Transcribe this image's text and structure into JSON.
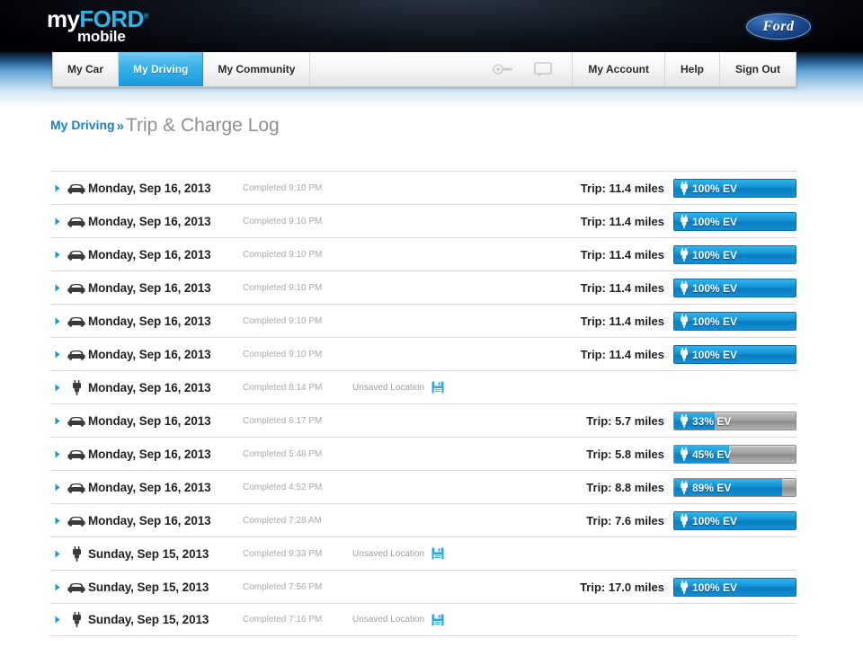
{
  "brand": {
    "logo_my": "my",
    "logo_ford": "FORD",
    "logo_tm": "®",
    "logo_mobile": "mobile",
    "oval_text": "Ford",
    "accent_blue": "#29b6ea",
    "active_tab_blue": "#1a9ade",
    "link_blue": "#1b7fc4"
  },
  "nav": {
    "tabs": [
      {
        "label": "My Car",
        "active": false
      },
      {
        "label": "My Driving",
        "active": true
      },
      {
        "label": "My Community",
        "active": false
      }
    ],
    "icons": [
      {
        "name": "key-icon"
      },
      {
        "name": "message-icon"
      }
    ],
    "links": [
      {
        "label": "My Account"
      },
      {
        "label": "Help"
      },
      {
        "label": "Sign Out"
      }
    ]
  },
  "breadcrumb": {
    "link": "My Driving",
    "separator": "»",
    "current": "Trip & Charge Log"
  },
  "log": {
    "rows": [
      {
        "type": "trip",
        "icon": "car-icon",
        "date": "Monday, Sep 16, 2013",
        "completed": "Completed 9:10 PM",
        "location": null,
        "trip": "Trip: 11.4 miles",
        "ev_label": "100% EV",
        "ev_percent": 100
      },
      {
        "type": "trip",
        "icon": "car-icon",
        "date": "Monday, Sep 16, 2013",
        "completed": "Completed 9:10 PM",
        "location": null,
        "trip": "Trip: 11.4 miles",
        "ev_label": "100% EV",
        "ev_percent": 100
      },
      {
        "type": "trip",
        "icon": "car-icon",
        "date": "Monday, Sep 16, 2013",
        "completed": "Completed 9:10 PM",
        "location": null,
        "trip": "Trip: 11.4 miles",
        "ev_label": "100% EV",
        "ev_percent": 100
      },
      {
        "type": "trip",
        "icon": "car-icon",
        "date": "Monday, Sep 16, 2013",
        "completed": "Completed 9:10 PM",
        "location": null,
        "trip": "Trip: 11.4 miles",
        "ev_label": "100% EV",
        "ev_percent": 100
      },
      {
        "type": "trip",
        "icon": "car-icon",
        "date": "Monday, Sep 16, 2013",
        "completed": "Completed 9:10 PM",
        "location": null,
        "trip": "Trip: 11.4 miles",
        "ev_label": "100% EV",
        "ev_percent": 100
      },
      {
        "type": "trip",
        "icon": "car-icon",
        "date": "Monday, Sep 16, 2013",
        "completed": "Completed 9:10 PM",
        "location": null,
        "trip": "Trip: 11.4 miles",
        "ev_label": "100% EV",
        "ev_percent": 100
      },
      {
        "type": "charge",
        "icon": "plug-icon",
        "date": "Monday, Sep 16, 2013",
        "completed": "Completed 8:14 PM",
        "location": "Unsaved Location",
        "trip": null,
        "ev_label": null,
        "ev_percent": null
      },
      {
        "type": "trip",
        "icon": "car-icon",
        "date": "Monday, Sep 16, 2013",
        "completed": "Completed 6:17 PM",
        "location": null,
        "trip": "Trip: 5.7 miles",
        "ev_label": "33% EV",
        "ev_percent": 33
      },
      {
        "type": "trip",
        "icon": "car-icon",
        "date": "Monday, Sep 16, 2013",
        "completed": "Completed 5:48 PM",
        "location": null,
        "trip": "Trip: 5.8 miles",
        "ev_label": "45% EV",
        "ev_percent": 45
      },
      {
        "type": "trip",
        "icon": "car-icon",
        "date": "Monday, Sep 16, 2013",
        "completed": "Completed 4:52 PM",
        "location": null,
        "trip": "Trip: 8.8 miles",
        "ev_label": "89% EV",
        "ev_percent": 89
      },
      {
        "type": "trip",
        "icon": "car-icon",
        "date": "Monday, Sep 16, 2013",
        "completed": "Completed 7:28 AM",
        "location": null,
        "trip": "Trip: 7.6 miles",
        "ev_label": "100% EV",
        "ev_percent": 100
      },
      {
        "type": "charge",
        "icon": "plug-icon",
        "date": "Sunday, Sep 15, 2013",
        "completed": "Completed 9:33 PM",
        "location": "Unsaved Location",
        "trip": null,
        "ev_label": null,
        "ev_percent": null
      },
      {
        "type": "trip",
        "icon": "car-icon",
        "date": "Sunday, Sep 15, 2013",
        "completed": "Completed 7:56 PM",
        "location": null,
        "trip": "Trip: 17.0 miles",
        "ev_label": "100% EV",
        "ev_percent": 100
      },
      {
        "type": "charge",
        "icon": "plug-icon",
        "date": "Sunday, Sep 15, 2013",
        "completed": "Completed 7:16 PM",
        "location": "Unsaved Location",
        "trip": null,
        "ev_label": null,
        "ev_percent": null
      }
    ]
  }
}
